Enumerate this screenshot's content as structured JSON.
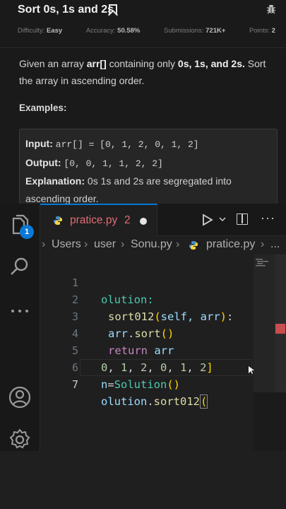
{
  "problem": {
    "title": "Sort 0s, 1s and 2s",
    "stats": {
      "difficulty_label": "Difficulty:",
      "difficulty": "Easy",
      "accuracy_label": "Accuracy:",
      "accuracy": "50.58%",
      "submissions_label": "Submissions:",
      "submissions": "721K+",
      "points_label": "Points:",
      "points": "2"
    },
    "description": {
      "p1": "Given an array ",
      "arr": "arr[]",
      "p2": " containing only ",
      "values": "0s, 1s, and 2s.",
      "p3": " Sort the array in ascending order."
    },
    "examples_heading": "Examples:",
    "example": {
      "input_label": "Input:",
      "input_value": "arr[] = [0, 1, 2, 0, 1, 2]",
      "output_label": "Output:",
      "output_value": "[0, 0, 1, 1, 2, 2]",
      "explanation_label": "Explanation:",
      "explanation_value": "0s 1s and 2s are segregated into ascending order."
    }
  },
  "editor": {
    "tab": {
      "filename": "pratice.py",
      "problem_count": "2",
      "dirty": true
    },
    "badge_count": "1",
    "breadcrumb": [
      "Users",
      "user",
      "Sonu.py",
      "pratice.py",
      "..."
    ],
    "line_numbers": [
      "1",
      "2",
      "3",
      "4",
      "5",
      "6",
      "7"
    ],
    "active_line": "7",
    "code": {
      "l1": "olution:",
      "l2_fn": "sort012",
      "l2_args": "self, arr",
      "l3_var": "arr",
      "l3_method": "sort",
      "l4_kw": "return",
      "l4_var": "arr",
      "l5_nums": [
        "0",
        "1",
        "2",
        "0",
        "1",
        "2"
      ],
      "l6_var": "n",
      "l6_cls": "Solution",
      "l7_var": "olution",
      "l7_method": "sort012"
    },
    "icons": [
      "explorer-icon",
      "search-icon",
      "more-icon",
      "account-icon",
      "settings-icon",
      "run-icon",
      "split-editor-icon"
    ]
  }
}
